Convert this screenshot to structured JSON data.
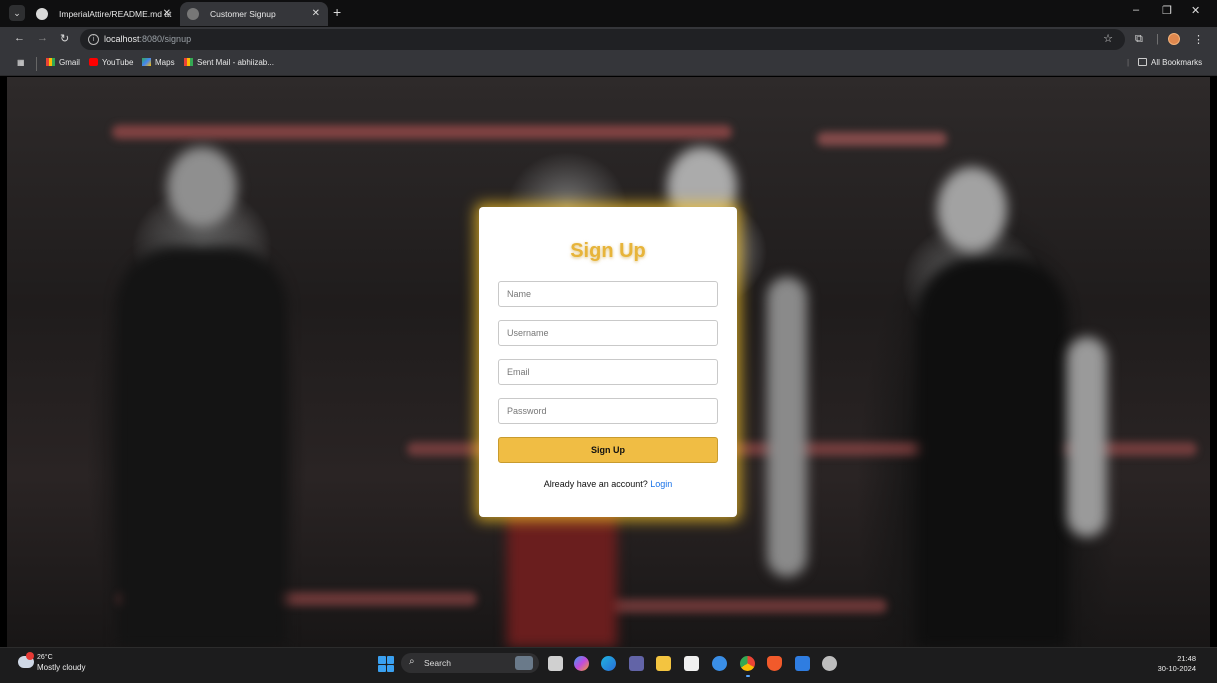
{
  "browser": {
    "tabs": [
      {
        "title": "ImperialAttire/README.md at ma",
        "active": false
      },
      {
        "title": "Customer Signup",
        "active": true
      }
    ],
    "new_tab": "+",
    "url_host": "localhost",
    "url_path": ":8080/signup",
    "window_controls": {
      "minimize": "–",
      "restore": "❐",
      "close": "✕"
    },
    "bookmarks": [
      {
        "label": "Gmail",
        "icon": "gmail-icon"
      },
      {
        "label": "YouTube",
        "icon": "youtube-icon"
      },
      {
        "label": "Maps",
        "icon": "maps-icon"
      },
      {
        "label": "Sent Mail - abhiizab...",
        "icon": "gmail-icon"
      }
    ],
    "all_bookmarks": "All Bookmarks"
  },
  "signup": {
    "title": "Sign Up",
    "name_placeholder": "Name",
    "username_placeholder": "Username",
    "email_placeholder": "Email",
    "password_placeholder": "Password",
    "submit_label": "Sign Up",
    "login_prompt": "Already have an account?",
    "login_link": "Login"
  },
  "taskbar": {
    "temperature": "26°C",
    "weather": "Mostly cloudy",
    "search_label": "Search",
    "time": "21:48",
    "date": "30-10-2024"
  }
}
